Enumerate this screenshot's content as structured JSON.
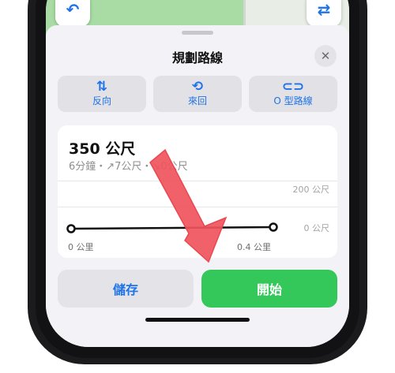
{
  "sheet": {
    "title": "規劃路線",
    "close_icon": "close-icon"
  },
  "options": [
    {
      "label": "反向",
      "icon": "⇅",
      "icon_name": "reverse-icon"
    },
    {
      "label": "來回",
      "icon": "⟲",
      "icon_name": "loop-path-icon"
    },
    {
      "label": "O 型路線",
      "icon": "⊂⊃",
      "icon_name": "loop-icon"
    }
  ],
  "route": {
    "distance": "350 公尺",
    "summary": "6分鐘・↗7公尺・↘0公尺"
  },
  "elevation_chart": {
    "y_labels": [
      "200 公尺",
      "0 公尺"
    ],
    "x_labels": [
      "0 公里",
      "0.4 公里"
    ]
  },
  "actions": {
    "save_label": "儲存",
    "start_label": "開始"
  },
  "colors": {
    "accent": "#1e73e8",
    "start": "#34c759",
    "annotation_arrow": "#f0545c"
  }
}
